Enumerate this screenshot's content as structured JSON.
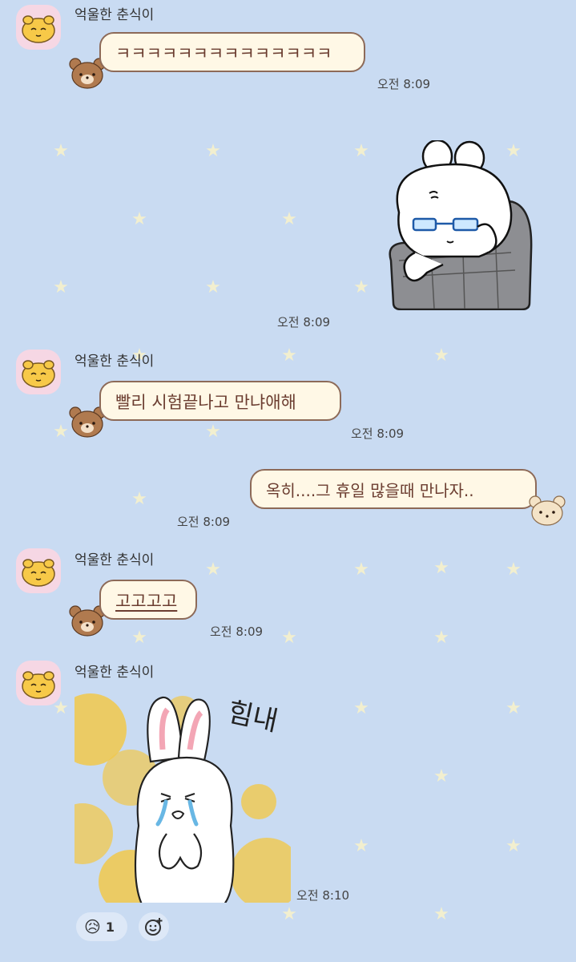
{
  "chat": {
    "sender_name": "억울한 춘식이",
    "messages": [
      {
        "type": "text",
        "from": "other",
        "text": "ㅋㅋㅋㅋㅋㅋㅋㅋㅋㅋㅋㅋㅋㅋ",
        "time": "오전 8:09"
      },
      {
        "type": "sticker",
        "from": "me",
        "sticker": "rabbit-glasses-armchair",
        "time": "오전 8:09"
      },
      {
        "type": "text",
        "from": "other",
        "text": "빨리 시험끝나고 만냐애해",
        "time": "오전 8:09"
      },
      {
        "type": "text",
        "from": "me",
        "text": "옥히....그 휴일 많을때 만나자..",
        "time": "오전 8:09"
      },
      {
        "type": "text",
        "from": "other",
        "text": "고고고고",
        "time": "오전 8:09"
      },
      {
        "type": "sticker",
        "from": "other",
        "sticker": "crying-rabbit",
        "sticker_text": "힘내",
        "time": "오전 8:10"
      }
    ],
    "reaction": {
      "emoji": "😥",
      "count": "1",
      "add_icon": "add-reaction-icon"
    }
  },
  "colors": {
    "background": "#c9dbf2",
    "bubble": "#fff8e6",
    "bubble_border": "#8d6a58",
    "text": "#6b3d30"
  }
}
